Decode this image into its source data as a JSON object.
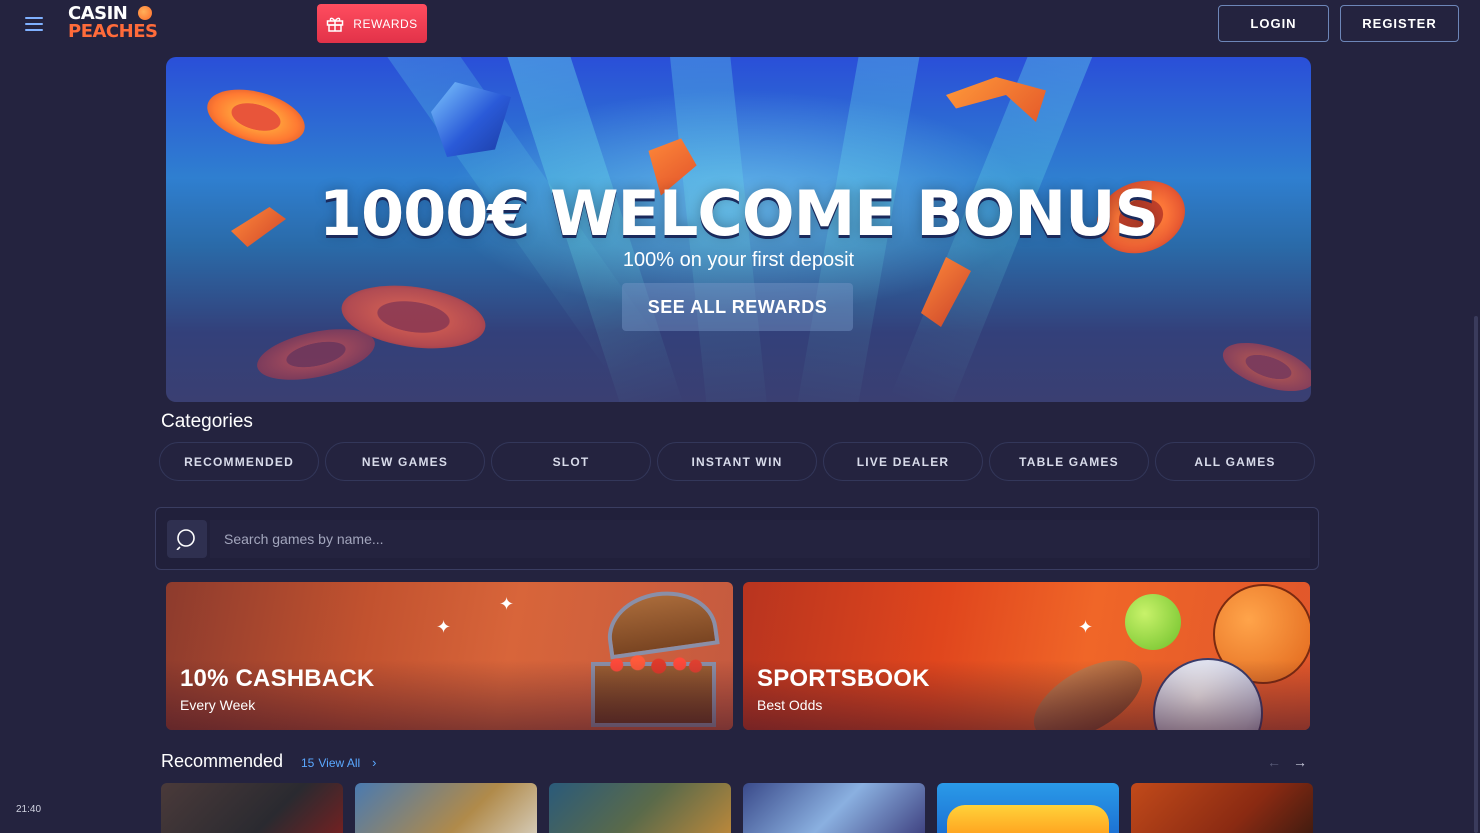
{
  "header": {
    "rewards_label": "REWARDS",
    "login_label": "LOGIN",
    "register_label": "REGISTER",
    "logo_line1": "CASIN",
    "logo_line2": "PEACHES"
  },
  "hero": {
    "title": "1000€ WELCOME BONUS",
    "subtitle": "100% on your first deposit",
    "cta_label": "SEE ALL REWARDS"
  },
  "categories": {
    "title": "Categories",
    "items": [
      "RECOMMENDED",
      "NEW GAMES",
      "SLOT",
      "INSTANT WIN",
      "LIVE DEALER",
      "TABLE GAMES",
      "ALL GAMES"
    ]
  },
  "search": {
    "placeholder": "Search games by name..."
  },
  "promos": [
    {
      "title": "10% CASHBACK",
      "subtitle": "Every Week"
    },
    {
      "title": "SPORTSBOOK",
      "subtitle": "Best Odds"
    }
  ],
  "recommended": {
    "title": "Recommended",
    "count": "15",
    "view_all": "View All"
  },
  "clock": "21:40",
  "colors": {
    "background": "#24233f",
    "rewards": "#e23249",
    "link": "#5aa8ff"
  }
}
